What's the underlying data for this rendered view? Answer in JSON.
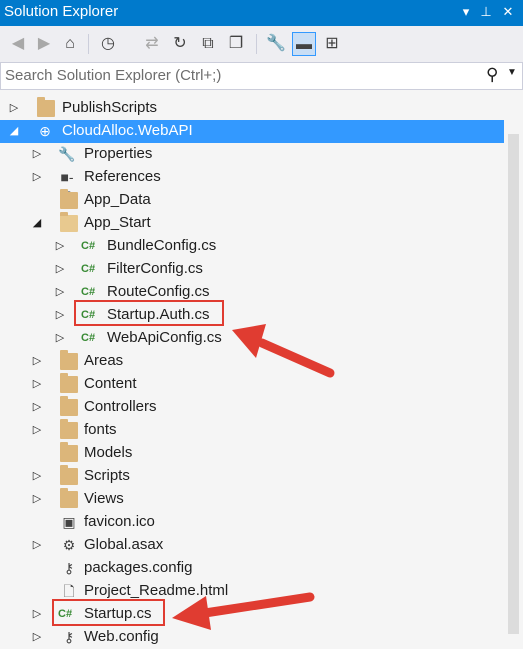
{
  "window": {
    "title": "Solution Explorer",
    "dropdown_icon": "dropdown-arrow-icon",
    "pin_icon": "pin-icon",
    "close_icon": "close-icon",
    "accent_color": "#007acc"
  },
  "search": {
    "placeholder": "Search Solution Explorer (Ctrl+;)",
    "icon": "search-icon"
  },
  "tree": {
    "items": [
      {
        "label": "PublishScripts",
        "icon": "folder-icon",
        "expander": "collapsed"
      },
      {
        "label": "CloudAlloc.WebAPI",
        "icon": "web-project-icon",
        "expander": "expanded",
        "selected": true
      },
      {
        "label": "Properties",
        "icon": "wrench-icon",
        "expander": "collapsed"
      },
      {
        "label": "References",
        "icon": "references-icon",
        "expander": "collapsed"
      },
      {
        "label": "App_Data",
        "icon": "folder-icon",
        "expander": "none"
      },
      {
        "label": "App_Start",
        "icon": "folder-open-icon",
        "expander": "expanded"
      },
      {
        "label": "BundleConfig.cs",
        "icon": "csharp-file-icon",
        "expander": "collapsed"
      },
      {
        "label": "FilterConfig.cs",
        "icon": "csharp-file-icon",
        "expander": "collapsed"
      },
      {
        "label": "RouteConfig.cs",
        "icon": "csharp-file-icon",
        "expander": "collapsed"
      },
      {
        "label": "Startup.Auth.cs",
        "icon": "csharp-file-icon",
        "expander": "collapsed"
      },
      {
        "label": "WebApiConfig.cs",
        "icon": "csharp-file-icon",
        "expander": "collapsed"
      },
      {
        "label": "Areas",
        "icon": "folder-icon",
        "expander": "collapsed"
      },
      {
        "label": "Content",
        "icon": "folder-icon",
        "expander": "collapsed"
      },
      {
        "label": "Controllers",
        "icon": "folder-icon",
        "expander": "collapsed"
      },
      {
        "label": "fonts",
        "icon": "folder-icon",
        "expander": "collapsed"
      },
      {
        "label": "Models",
        "icon": "folder-icon",
        "expander": "none"
      },
      {
        "label": "Scripts",
        "icon": "folder-icon",
        "expander": "collapsed"
      },
      {
        "label": "Views",
        "icon": "folder-icon",
        "expander": "collapsed"
      },
      {
        "label": "favicon.ico",
        "icon": "icon-file-icon",
        "expander": "none"
      },
      {
        "label": "Global.asax",
        "icon": "global-asax-icon",
        "expander": "collapsed"
      },
      {
        "label": "packages.config",
        "icon": "config-file-icon",
        "expander": "none"
      },
      {
        "label": "Project_Readme.html",
        "icon": "html-file-icon",
        "expander": "none"
      },
      {
        "label": "Startup.cs",
        "icon": "csharp-file-icon",
        "expander": "collapsed"
      },
      {
        "label": "Web.config",
        "icon": "config-file-icon",
        "expander": "collapsed"
      }
    ]
  },
  "annotations": {
    "highlight_color": "#e03c31",
    "highlighted_items": [
      "Startup.Auth.cs",
      "Startup.cs"
    ]
  },
  "colors": {
    "selection": "#3399ff",
    "folder": "#dcb67a",
    "csharp": "#388a34"
  }
}
